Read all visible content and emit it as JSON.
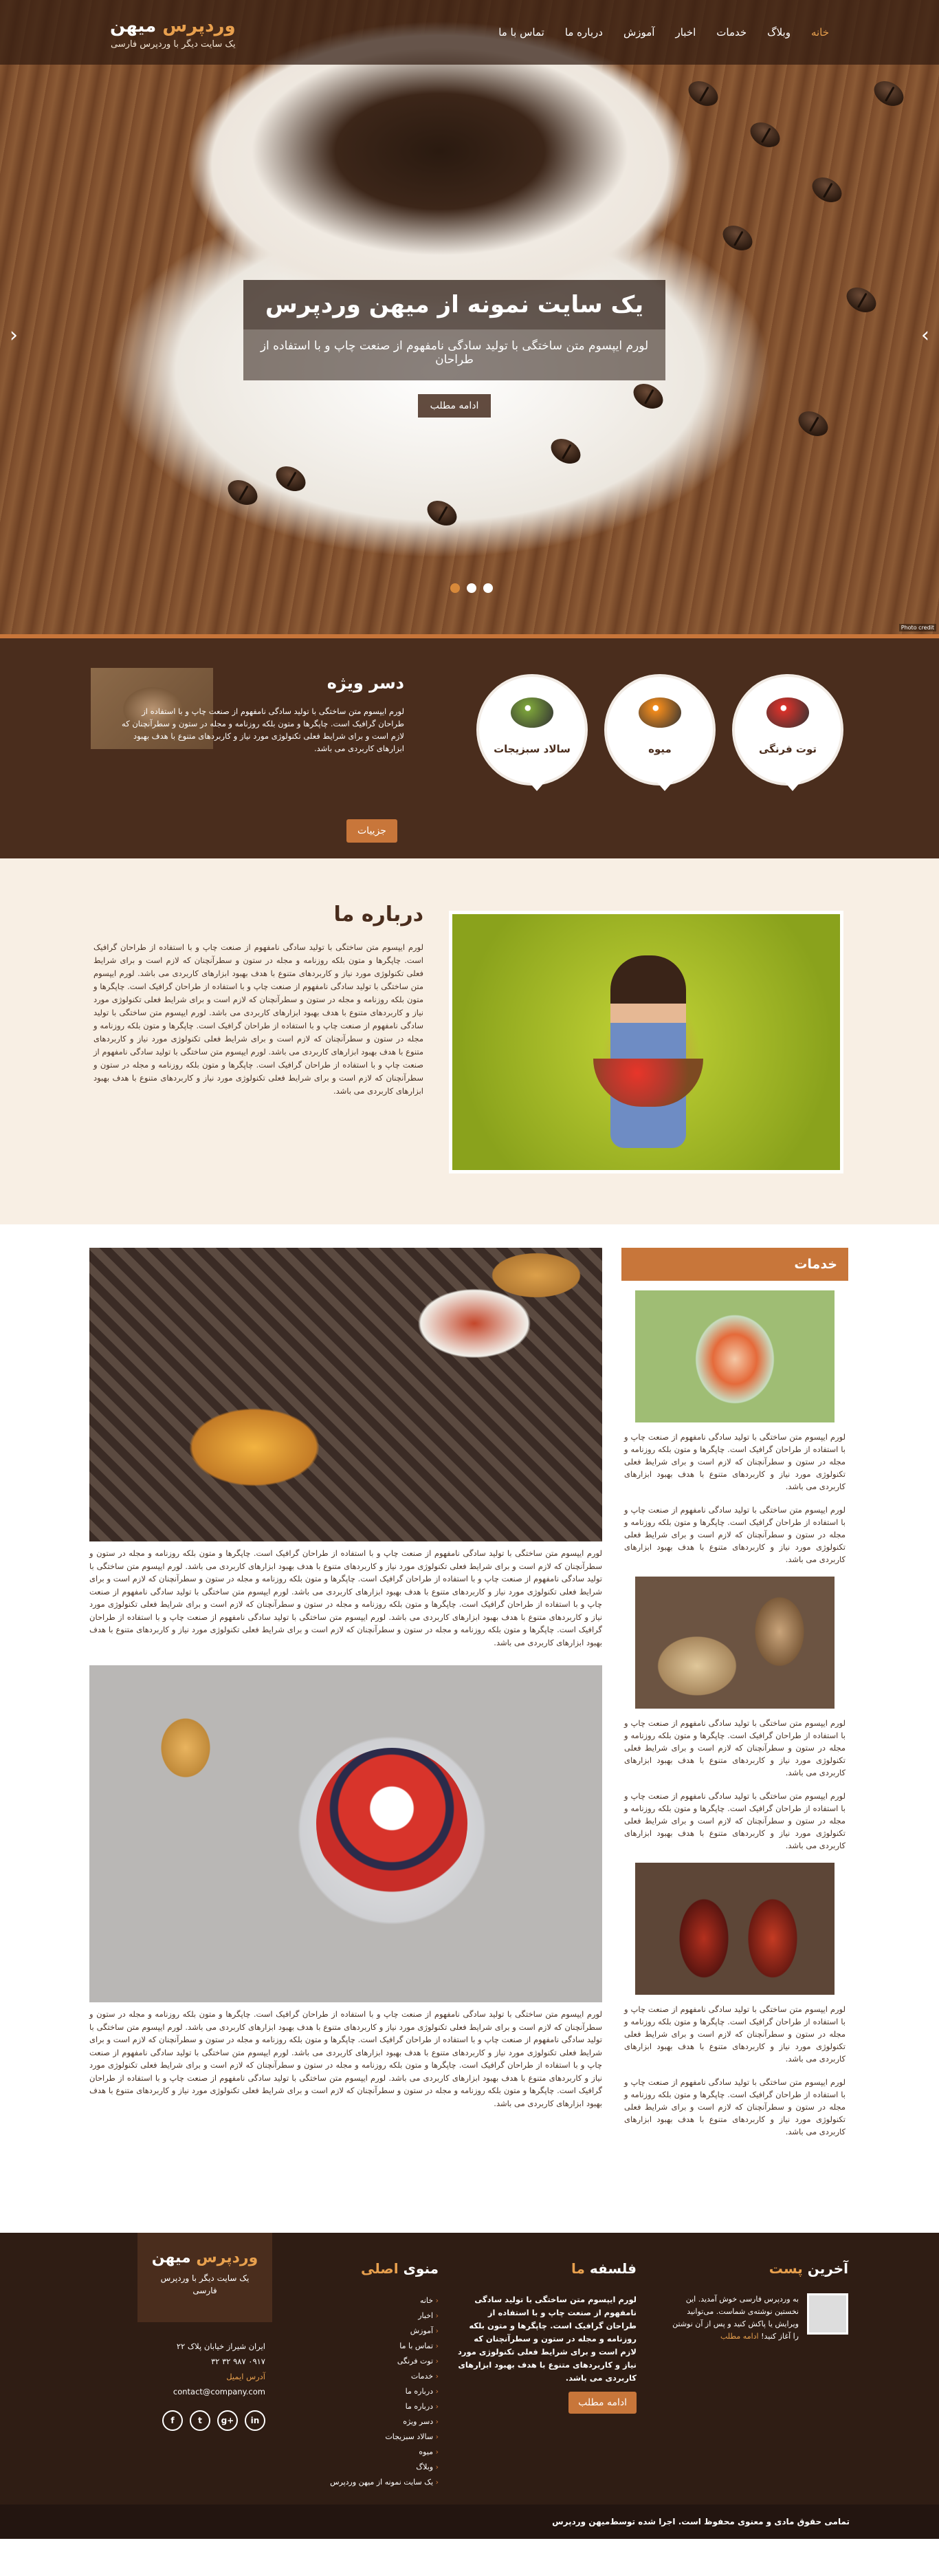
{
  "header": {
    "brand_main": "میهن",
    "brand_accent": "وردپرس",
    "tagline": "یک سایت دیگر با وردپرس فارسی",
    "nav": [
      "خانه",
      "وبلاگ",
      "خدمات",
      "اخبار",
      "آموزش",
      "درباره ما",
      "تماس با ما"
    ],
    "nav_active_index": 0
  },
  "slider": {
    "title": "یک سایت نمونه از میهن وردپرس",
    "text": "لورم ایپسوم متن ساختگی با تولید سادگی نامفهوم از صنعت چاپ و با استفاده از طراحان",
    "button": "ادامه مطلب",
    "dots": 3,
    "active_dot": 2,
    "prev_icon": "chevron-left-icon",
    "next_icon": "chevron-right-icon",
    "credit": "Photo credit"
  },
  "special": {
    "circles": [
      {
        "label": "سالاد سبزیجات",
        "icon": "salad-icon",
        "color": "#7aa03a"
      },
      {
        "label": "میوه",
        "icon": "fruit-icon",
        "color": "#f08a1c"
      },
      {
        "label": "توت فرنگی",
        "icon": "strawberry-icon",
        "color": "#d6322a"
      }
    ],
    "title": "دسر ویژه",
    "text": "لورم ایپسوم متن ساختگی با تولید سادگی نامفهوم از صنعت چاپ و با استفاده از طراحان گرافیک است. چاپگرها و متون بلکه روزنامه و مجله در ستون و سطرآنچنان که لازم است و برای شرایط فعلی تکنولوژی مورد نیاز و کاربردهای متنوع با هدف بهبود ابزارهای کاربردی می باشد.",
    "button": "جزییات"
  },
  "about": {
    "title": "درباره ما",
    "text": "لورم ایپسوم متن ساختگی با تولید سادگی نامفهوم از صنعت چاپ و با استفاده از طراحان گرافیک است. چاپگرها و متون بلکه روزنامه و مجله در ستون و سطرآنچنان که لازم است و برای شرایط فعلی تکنولوژی مورد نیاز و کاربردهای متنوع با هدف بهبود ابزارهای کاربردی می باشد. لورم ایپسوم متن ساختگی با تولید سادگی نامفهوم از صنعت چاپ و با استفاده از طراحان گرافیک است. چاپگرها و متون بلکه روزنامه و مجله در ستون و سطرآنچنان که لازم است و برای شرایط فعلی تکنولوژی مورد نیاز و کاربردهای متنوع با هدف بهبود ابزارهای کاربردی می باشد. لورم ایپسوم متن ساختگی با تولید سادگی نامفهوم از صنعت چاپ و با استفاده از طراحان گرافیک است. چاپگرها و متون بلکه روزنامه و مجله در ستون و سطرآنچنان که لازم است و برای شرایط فعلی تکنولوژی مورد نیاز و کاربردهای متنوع با هدف بهبود ابزارهای کاربردی می باشد. لورم ایپسوم متن ساختگی با تولید سادگی نامفهوم از صنعت چاپ و با استفاده از طراحان گرافیک است. چاپگرها و متون بلکه روزنامه و مجله در ستون و سطرآنچنان که لازم است و برای شرایط فعلی تکنولوژی مورد نیاز و کاربردهای متنوع با هدف بهبود ابزارهای کاربردی می باشد."
  },
  "posts": [
    {
      "text": "لورم ایپسوم متن ساختگی با تولید سادگی نامفهوم از صنعت چاپ و با استفاده از طراحان گرافیک است. چاپگرها و متون بلکه روزنامه و مجله در ستون و سطرآنچنان که لازم است و برای شرایط فعلی تکنولوژی مورد نیاز و کاربردهای متنوع با هدف بهبود ابزارهای کاربردی می باشد. لورم ایپسوم متن ساختگی با تولید سادگی نامفهوم از صنعت چاپ و با استفاده از طراحان گرافیک است. چاپگرها و متون بلکه روزنامه و مجله در ستون و سطرآنچنان که لازم است و برای شرایط فعلی تکنولوژی مورد نیاز و کاربردهای متنوع با هدف بهبود ابزارهای کاربردی می باشد. لورم ایپسوم متن ساختگی با تولید سادگی نامفهوم از صنعت چاپ و با استفاده از طراحان گرافیک است. چاپگرها و متون بلکه روزنامه و مجله در ستون و سطرآنچنان که لازم است و برای شرایط فعلی تکنولوژی مورد نیاز و کاربردهای متنوع با هدف بهبود ابزارهای کاربردی می باشد. لورم ایپسوم متن ساختگی با تولید سادگی نامفهوم از صنعت چاپ و با استفاده از طراحان گرافیک است. چاپگرها و متون بلکه روزنامه و مجله در ستون و سطرآنچنان که لازم است و برای شرایط فعلی تکنولوژی مورد نیاز و کاربردهای متنوع با هدف بهبود ابزارهای کاربردی می باشد."
    },
    {
      "text": "لورم ایپسوم متن ساختگی با تولید سادگی نامفهوم از صنعت چاپ و با استفاده از طراحان گرافیک است. چاپگرها و متون بلکه روزنامه و مجله در ستون و سطرآنچنان که لازم است و برای شرایط فعلی تکنولوژی مورد نیاز و کاربردهای متنوع با هدف بهبود ابزارهای کاربردی می باشد. لورم ایپسوم متن ساختگی با تولید سادگی نامفهوم از صنعت چاپ و با استفاده از طراحان گرافیک است. چاپگرها و متون بلکه روزنامه و مجله در ستون و سطرآنچنان که لازم است و برای شرایط فعلی تکنولوژی مورد نیاز و کاربردهای متنوع با هدف بهبود ابزارهای کاربردی می باشد. لورم ایپسوم متن ساختگی با تولید سادگی نامفهوم از صنعت چاپ و با استفاده از طراحان گرافیک است. چاپگرها و متون بلکه روزنامه و مجله در ستون و سطرآنچنان که لازم است و برای شرایط فعلی تکنولوژی مورد نیاز و کاربردهای متنوع با هدف بهبود ابزارهای کاربردی می باشد. لورم ایپسوم متن ساختگی با تولید سادگی نامفهوم از صنعت چاپ و با استفاده از طراحان گرافیک است. چاپگرها و متون بلکه روزنامه و مجله در ستون و سطرآنچنان که لازم است و برای شرایط فعلی تکنولوژی مورد نیاز و کاربردهای متنوع با هدف بهبود ابزارهای کاربردی می باشد."
    }
  ],
  "sidebar": {
    "title": "خدمات",
    "text": "لورم ایپسوم متن ساختگی با تولید سادگی نامفهوم از صنعت چاپ و با استفاده از طراحان گرافیک است. چاپگرها و متون بلکه روزنامه و مجله در ستون و سطرآنچنان که لازم است و برای شرایط فعلی تکنولوژی مورد نیاز و کاربردهای متنوع با هدف بهبود ابزارهای کاربردی می باشد."
  },
  "footer": {
    "recent_title_main": "آخرین",
    "recent_title_accent": "پست",
    "recent_text": "به وردپرس فارسی خوش آمدید. این نخستین نوشته‌ی شماست. می‌توانید ویرایش یا پاکش کنید و پس از آن نوشتن را آغاز کنید!",
    "recent_more": "ادامه مطلب",
    "philo_main": "فلسفه",
    "philo_accent": "ما",
    "philo_text": "لورم ایپسوم متن ساختگی با تولید سادگی نامفهوم از صنعت چاپ و با استفاده از طراحان گرافیک است. چاپگرها و متون بلکه روزنامه و مجله در ستون و سطرآنچنان که لازم است و برای شرایط فعلی تکنولوژی مورد نیاز و کاربردهای متنوع با هدف بهبود ابزارهای کاربردی می باشد.",
    "philo_button": "ادامه مطلب",
    "menu_main": "منوی",
    "menu_accent": "اصلی",
    "menu": [
      "خانه",
      "اخبار",
      "آموزش",
      "تماس با ما",
      "توت فرنگی",
      "خدمات",
      "درباره ما",
      "درباره ما",
      "دسر ویژه",
      "سالاد سبزیجات",
      "میوه",
      "وبلاگ",
      "یک سایت نمونه از میهن وردپرس"
    ],
    "brand_main": "میهن",
    "brand_accent": "وردپرس",
    "brand_tag": "یک سایت دیگر با وردپرس فارسی",
    "address": "ایران شیراز خیابان پلاک ۲۲",
    "phone": "۰۹۱۷ ۹۸۷ ۳۲ ۳۲",
    "email_label": "آدرس ایمیل",
    "email": "contact@company.com",
    "social": [
      "f",
      "t",
      "g+",
      "in"
    ],
    "copyright": "تمامی حقوق مادی و معنوی محفوظ است. اجرا شده توسط",
    "copyright_link": "میهن وردپرس"
  }
}
